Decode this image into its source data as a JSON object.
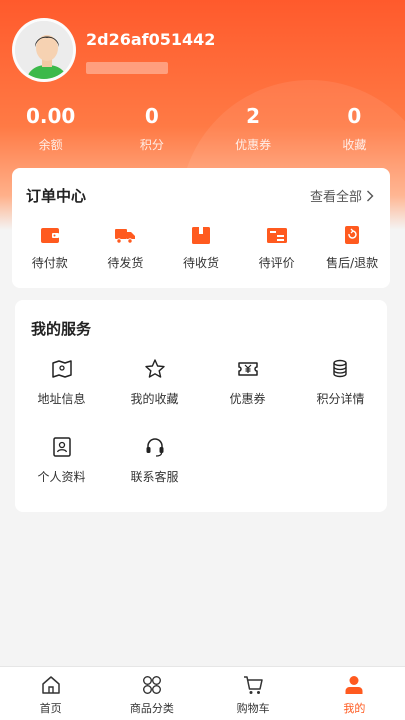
{
  "colors": {
    "accent": "#ff5a1f",
    "header_start": "#ff5a2c",
    "header_end": "#ffb08a",
    "background": "#f4f4f4"
  },
  "profile": {
    "username": "2d26af051442",
    "avatar_icon": "avatar-icon"
  },
  "stats": [
    {
      "value": "0.00",
      "label": "余额"
    },
    {
      "value": "0",
      "label": "积分"
    },
    {
      "value": "2",
      "label": "优惠券"
    },
    {
      "value": "0",
      "label": "收藏"
    }
  ],
  "orders": {
    "title": "订单中心",
    "view_all": "查看全部",
    "items": [
      {
        "label": "待付款",
        "icon": "wallet-icon"
      },
      {
        "label": "待发货",
        "icon": "truck-icon"
      },
      {
        "label": "待收货",
        "icon": "package-icon"
      },
      {
        "label": "待评价",
        "icon": "review-icon"
      },
      {
        "label": "售后/退款",
        "icon": "refund-icon"
      }
    ]
  },
  "services": {
    "title": "我的服务",
    "items": [
      {
        "label": "地址信息",
        "icon": "map-icon"
      },
      {
        "label": "我的收藏",
        "icon": "star-icon"
      },
      {
        "label": "优惠券",
        "icon": "coupon-icon"
      },
      {
        "label": "积分详情",
        "icon": "coins-icon"
      },
      {
        "label": "个人资料",
        "icon": "profile-card-icon"
      },
      {
        "label": "联系客服",
        "icon": "headset-icon"
      }
    ]
  },
  "tabbar": [
    {
      "label": "首页",
      "icon": "home-icon"
    },
    {
      "label": "商品分类",
      "icon": "grid-icon"
    },
    {
      "label": "购物车",
      "icon": "cart-icon"
    },
    {
      "label": "我的",
      "icon": "user-icon",
      "active": true
    }
  ]
}
